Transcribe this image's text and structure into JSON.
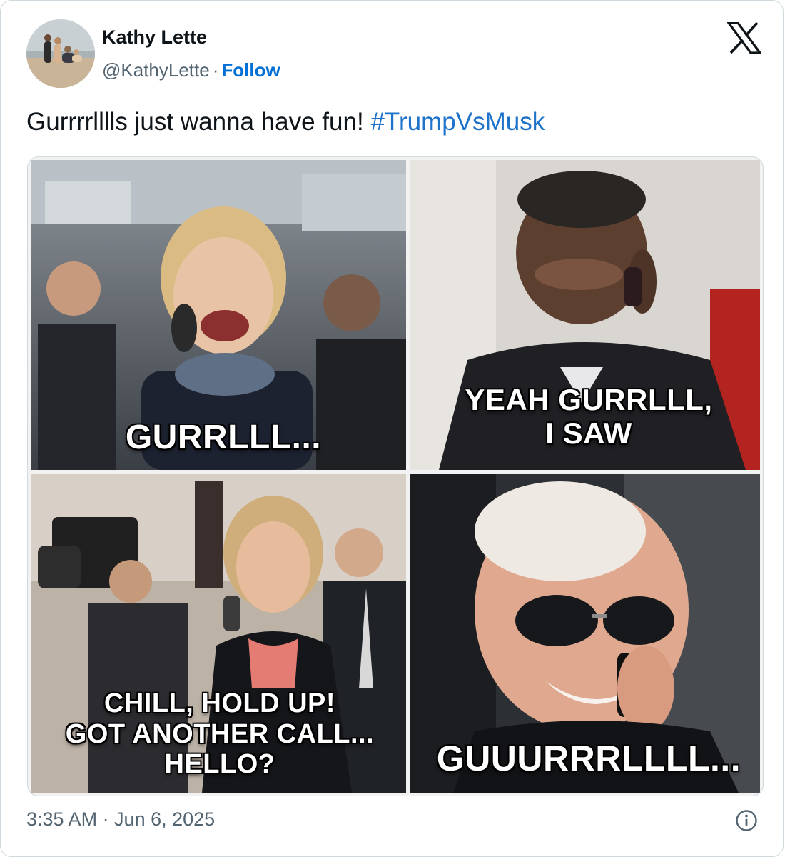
{
  "author": {
    "name": "Kathy Lette",
    "handle": "@KathyLette",
    "separator": "·",
    "follow_label": "Follow"
  },
  "tweet": {
    "text": "Gurrrrlllls just wanna have fun!",
    "hashtag": "#TrumpVsMusk"
  },
  "media": {
    "panels": [
      {
        "caption_lines": [
          "GURRLLL..."
        ]
      },
      {
        "caption_lines": [
          "YEAH GURRLLL,",
          "I SAW"
        ]
      },
      {
        "caption_lines": [
          "CHILL, HOLD UP!",
          "GOT ANOTHER CALL...",
          "HELLO?"
        ]
      },
      {
        "caption_lines": [
          "GUUURRRLLLL..."
        ]
      }
    ]
  },
  "footer": {
    "timestamp": "3:35 AM · Jun 6, 2025"
  },
  "icons": {
    "platform": "x-logo-icon",
    "info": "info-icon"
  }
}
